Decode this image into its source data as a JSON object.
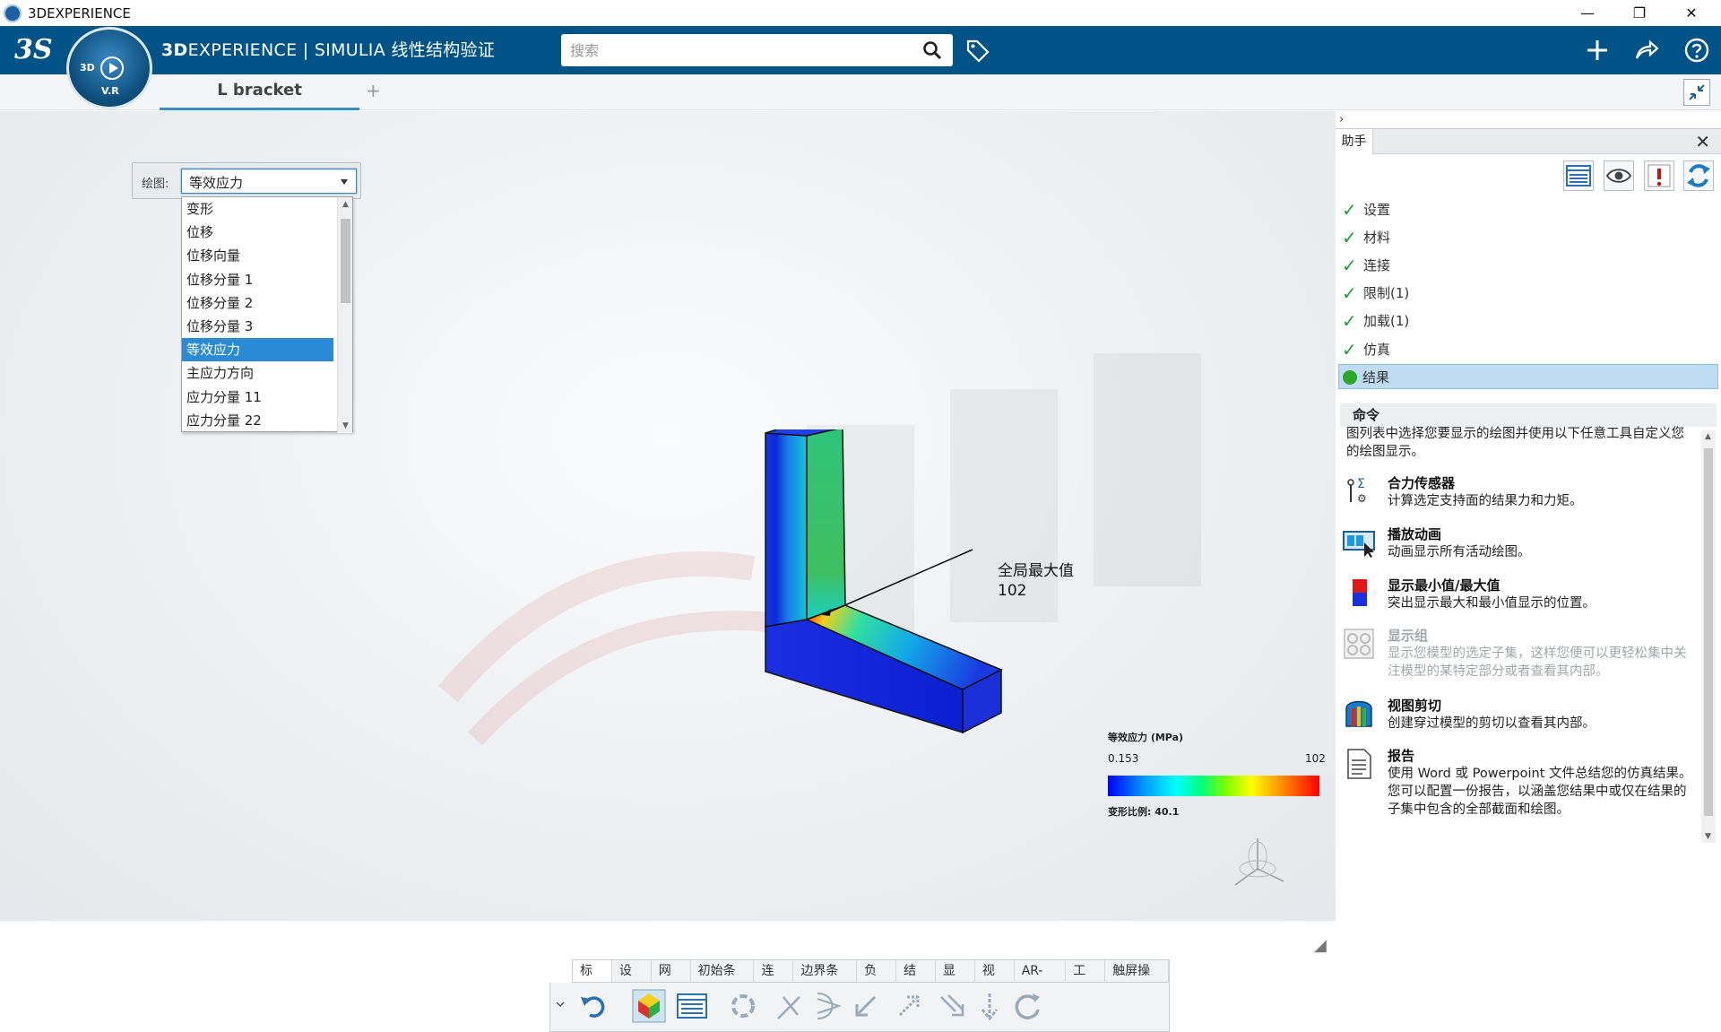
{
  "window": {
    "title": "3DEXPERIENCE",
    "minimize": "—",
    "restore": "❐",
    "close": "✕"
  },
  "topbar": {
    "logo": "3S",
    "brand_bold": "3D",
    "brand_rest": "EXPERIENCE | SIMULIA 线性结构验证",
    "search_placeholder": "搜索",
    "compass": {
      "label_3d": "3D",
      "label_vr": "V.R"
    }
  },
  "tabs": {
    "active": "L bracket",
    "add": "+"
  },
  "plot": {
    "label": "绘图:",
    "selected": "等效应力",
    "options": [
      "变形",
      "位移",
      "位移向量",
      "位移分量 1",
      "位移分量 2",
      "位移分量 3",
      "等效应力",
      "主应力方向",
      "应力分量 11",
      "应力分量 22"
    ],
    "selected_index": 6
  },
  "annotation": {
    "title": "全局最大值",
    "value": "102"
  },
  "legend": {
    "title": "等效应力 (MPa)",
    "min": "0.153",
    "max": "102",
    "scale": "变形比例: 40.1",
    "colors": [
      "#0000ff",
      "#00a0ff",
      "#00ffff",
      "#00ff80",
      "#80ff00",
      "#ffff00",
      "#ff8000",
      "#ff0000"
    ]
  },
  "bottom_tabs": [
    "标准",
    "设置",
    "网格",
    "初始条件",
    "连接",
    "边界条件",
    "负载",
    "结果",
    "显示",
    "视图",
    "AR-VR",
    "工具",
    "触屏操作"
  ],
  "assistant": {
    "expand": "›",
    "tab": "助手",
    "close": "✕",
    "steps": [
      {
        "label": "设置",
        "status": "done"
      },
      {
        "label": "材料",
        "status": "done"
      },
      {
        "label": "连接",
        "status": "done"
      },
      {
        "label": "限制(1)",
        "status": "done"
      },
      {
        "label": "加载(1)",
        "status": "done"
      },
      {
        "label": "仿真",
        "status": "done"
      },
      {
        "label": "结果",
        "status": "current"
      }
    ],
    "commands_header": "命令",
    "commands_desc": "图列表中选择您要显示的绘图并使用以下任意工具自定义您的绘图显示。",
    "commands": [
      {
        "title": "合力传感器",
        "desc": "计算选定支持面的结果力和力矩。"
      },
      {
        "title": "播放动画",
        "desc": "动画显示所有活动绘图。"
      },
      {
        "title": "显示最小值/最大值",
        "desc": "突出显示最大和最小值显示的位置。"
      },
      {
        "title": "显示组",
        "desc": "显示您模型的选定子集，这样您便可以更轻松集中关注模型的某特定部分或者查看其内部。"
      },
      {
        "title": "视图剪切",
        "desc": "创建穿过模型的剪切以查看其内部。"
      },
      {
        "title": "报告",
        "desc": "使用 Word 或 Powerpoint 文件总结您的仿真结果。您可以配置一份报告，以涵盖您结果中或仅在结果的子集中包含的全部截面和绘图。"
      }
    ]
  }
}
